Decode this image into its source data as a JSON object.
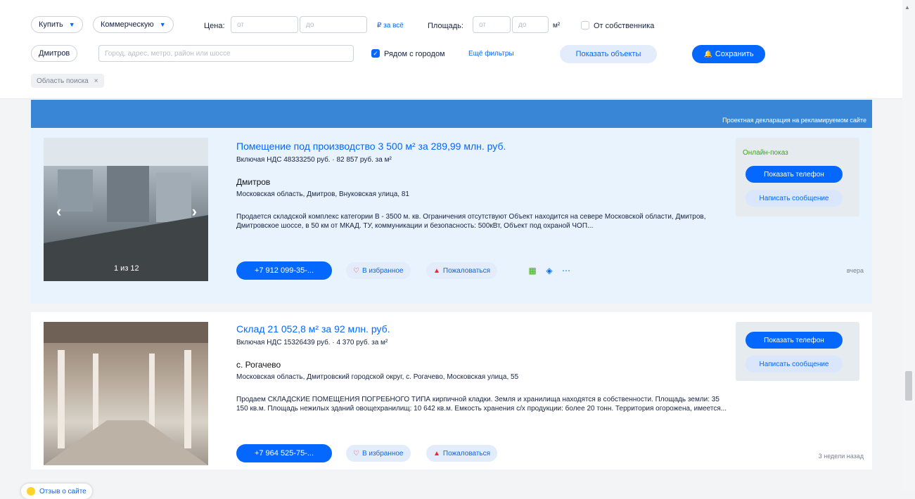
{
  "filters": {
    "deal_type": "Купить",
    "property_type": "Коммерческую",
    "price_label": "Цена:",
    "price_from_placeholder": "от",
    "price_to_placeholder": "до",
    "price_unit": "₽ за всё",
    "area_label": "Площадь:",
    "area_from_placeholder": "от",
    "area_to_placeholder": "до",
    "area_unit": "м²",
    "owner_label": "От собственника",
    "city": "Дмитров",
    "search_placeholder": "Город, адрес, метро, район или шоссе",
    "near_city_label": "Рядом с городом",
    "more_filters": "Ещё фильтры",
    "show_objects": "Показать объекты",
    "save": "Сохранить",
    "area_chip": "Область поиска",
    "chip_close": "×"
  },
  "banner": {
    "text": "Проектная декларация на рекламируемом сайте"
  },
  "listings": [
    {
      "title": "Помещение под производство 3 500 м² за 289,99 млн. руб.",
      "vat": "Включая НДС 48333250 руб. · 82 857 руб. за м²",
      "location": "Дмитров",
      "address": "Московская область, Дмитров, Внуковская улица, 81",
      "description": "Продается складской комплекс категории В - 3500 м. кв. Ограничения отсутствуют Объект находится на севере Московской области, Дмитров, Дмитровское шоссе, в 50 км от МКАД. ТУ, коммуникации и безопасность: 500кВт, Объект под охраной ЧОП...",
      "photo_counter": "1 из 12",
      "phone": "+7 912 099-35-...",
      "favorite": "В избранное",
      "complain": "Пожаловаться",
      "online_show": "Онлайн-показ",
      "show_phone": "Показать телефон",
      "write_message": "Написать сообщение",
      "date": "вчера"
    },
    {
      "title": "Склад 21 052,8 м² за 92 млн. руб.",
      "vat": "Включая НДС 15326439 руб. · 4 370 руб. за м²",
      "location": "с. Рогачево",
      "address": "Московская область, Дмитровский городской округ, с. Рогачево, Московская улица, 55",
      "description": "Продаем СКЛАДСКИЕ ПОМЕЩЕНИЯ ПОГРЕБНОГО ТИПА кирпичной кладки. Земля и хранилища находятся в собственности. Площадь земли: 35 150 кв.м. Площадь нежилых зданий овощехранилищ: 10 642 кв.м. Емкость хранения с/х продукции: более 20 тонн. Территория огорожена, имеется...",
      "phone": "+7 964 525-75-...",
      "favorite": "В избранное",
      "complain": "Пожаловаться",
      "show_phone": "Показать телефон",
      "write_message": "Написать сообщение",
      "date": "3 недели назад"
    }
  ],
  "help": {
    "label": "Отзыв о сайте"
  },
  "colors": {
    "accent": "#0468ff",
    "banner": "#3a86d6",
    "highlight_card": "#e8f3fd",
    "online": "#34ac0a"
  }
}
